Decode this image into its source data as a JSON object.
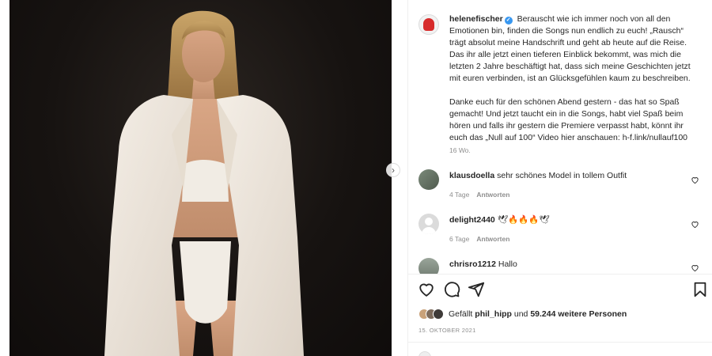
{
  "post": {
    "owner": "helenefischer",
    "verified_mark": "✓",
    "caption_p1": "Berauscht wie ich immer noch von all den Emotionen bin, finden die Songs nun endlich zu euch! „Rausch“ trägt absolut meine Handschrift und geht ab heute auf die Reise. Das ihr alle jetzt einen tieferen Einblick bekommt, was mich die letzten 2 Jahre beschäftigt hat, dass sich meine Geschichten jetzt mit euren verbinden, ist an Glücksgefühlen kaum zu beschreiben.",
    "caption_p2": "Danke euch für den schönen Abend gestern - das hat so Spaß gemacht! Und jetzt taucht ein in die Songs, habt viel Spaß beim hören und falls ihr gestern die Premiere verpasst habt, könnt ihr euch das „Null auf 100“ Video hier anschauen: h-f.link/nullauf100",
    "caption_age": "16 Wo."
  },
  "comments": [
    {
      "user": "klausdoella",
      "text": "sehr schönes Model in tollem Outfit",
      "age": "4 Tage",
      "reply": "Antworten"
    },
    {
      "user": "delight2440",
      "text": "🕊🔥🔥🔥🕊",
      "age": "6 Tage",
      "reply": "Antworten"
    },
    {
      "user": "chrisro1212",
      "text": "Hallo"
    }
  ],
  "likes": {
    "prefix": "Gefällt",
    "first_user": "phil_hipp",
    "connector": "und",
    "others": "59.244 weitere Personen"
  },
  "date": "15. OKTOBER 2021",
  "carousel_next": "›",
  "icons": [
    "heart-icon",
    "comment-icon",
    "share-icon",
    "bookmark-icon",
    "chevron-right-icon"
  ]
}
